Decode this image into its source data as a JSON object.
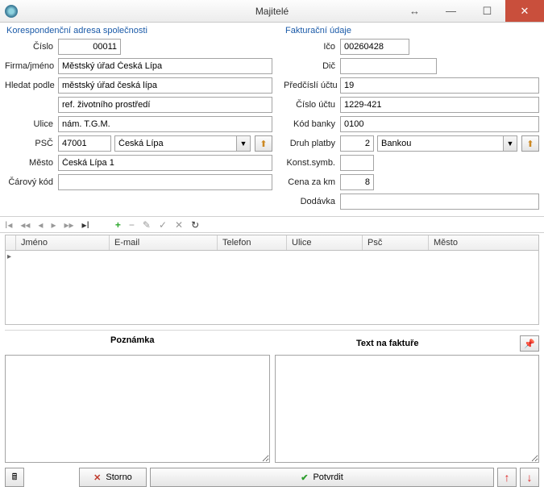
{
  "window": {
    "title": "Majitelé"
  },
  "left": {
    "section": "Korespondenční adresa společnosti",
    "labels": {
      "cislo": "Číslo",
      "firma": "Firma/jméno",
      "hledat": "Hledat podle",
      "ulice": "Ulice",
      "psc": "PSČ",
      "mesto": "Město",
      "carovy": "Čárový kód"
    },
    "values": {
      "cislo": "00011",
      "firma": "Městský úřad Česká Lípa",
      "hledat": "městský úřad česká lípa",
      "ref": "ref. životního prostředí",
      "ulice": "nám. T.G.M.",
      "psc": "47001",
      "psc_city": "Česká Lípa",
      "mesto": "Česká Lípa 1",
      "carovy": ""
    }
  },
  "right": {
    "section": "Fakturační údaje",
    "labels": {
      "ico": "Ičo",
      "dic": "Dič",
      "predcisli": "Předčíslí účtu",
      "cislo_uctu": "Číslo účtu",
      "kod_banky": "Kód banky",
      "druh_platby": "Druh platby",
      "konst": "Konst.symb.",
      "cena_km": "Cena za km",
      "dodavka": "Dodávka"
    },
    "values": {
      "ico": "00260428",
      "dic": "",
      "predcisli": "19",
      "cislo_uctu": "1229-421",
      "kod_banky": "0100",
      "druh_platby_num": "2",
      "druh_platby_text": "Bankou",
      "konst": "",
      "cena_km": "8",
      "dodavka": ""
    }
  },
  "grid": {
    "cols": {
      "jmeno": "Jméno",
      "email": "E-mail",
      "telefon": "Telefon",
      "ulice": "Ulice",
      "psc": "Psč",
      "mesto": "Město"
    }
  },
  "mid": {
    "poznamka": "Poznámka",
    "faktura": "Text na faktuře"
  },
  "buttons": {
    "storno": "Storno",
    "potvrdit": "Potvrdit"
  }
}
